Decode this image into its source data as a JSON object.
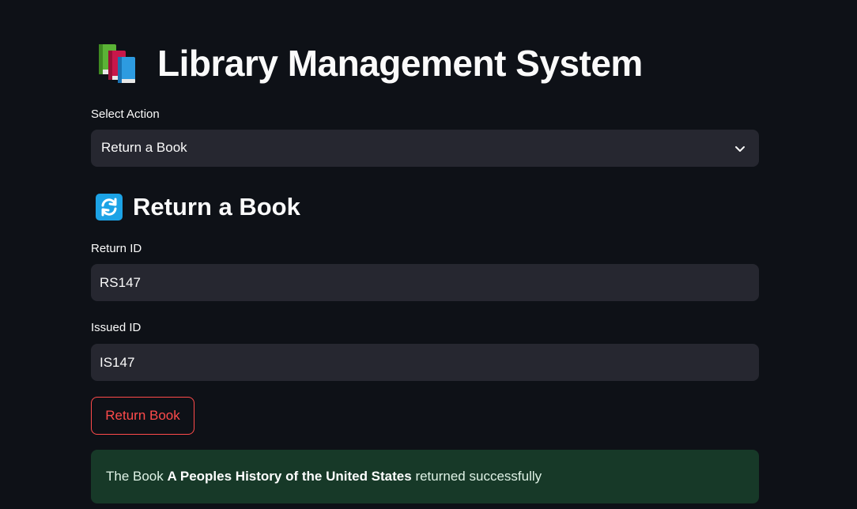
{
  "header": {
    "title": "Library Management System",
    "icon": "books-icon"
  },
  "select_action": {
    "label": "Select Action",
    "value": "Return a Book"
  },
  "section": {
    "title": "Return a Book",
    "icon": "refresh-icon"
  },
  "return_id": {
    "label": "Return ID",
    "value": "RS147"
  },
  "issued_id": {
    "label": "Issued ID",
    "value": "IS147"
  },
  "submit_button": {
    "label": "Return Book"
  },
  "success_message": {
    "prefix": "The Book ",
    "book_title": "A Peoples History of the United States",
    "suffix": " returned successfully"
  },
  "colors": {
    "background": "#0e1117",
    "input_background": "#262730",
    "accent": "#ff4b4b",
    "success_background": "#173928"
  }
}
